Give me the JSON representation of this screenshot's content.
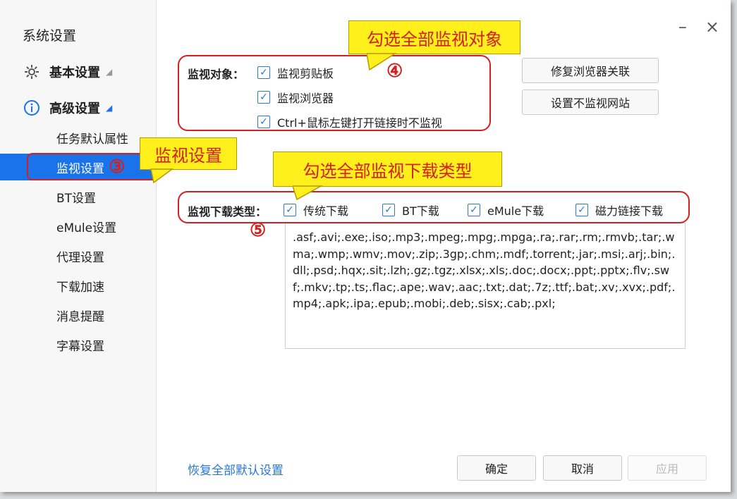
{
  "sidebar": {
    "title": "系统设置",
    "groups": [
      {
        "label": "基本设置",
        "arrow": "◢",
        "icon": "gear-icon"
      },
      {
        "label": "高级设置",
        "arrow": "◢",
        "icon": "info-icon"
      }
    ],
    "items": [
      {
        "label": "任务默认属性"
      },
      {
        "label": "监视设置"
      },
      {
        "label": "BT设置"
      },
      {
        "label": "eMule设置"
      },
      {
        "label": "代理设置"
      },
      {
        "label": "下载加速"
      },
      {
        "label": "消息提醒"
      },
      {
        "label": "字幕设置"
      }
    ]
  },
  "window_controls": {
    "minimize": "–",
    "close": "×"
  },
  "monitor_targets": {
    "label": "监视对象：",
    "options": [
      {
        "label": "监视剪贴板",
        "checked": true
      },
      {
        "label": "监视浏览器",
        "checked": true
      },
      {
        "label": "Ctrl+鼠标左键打开链接时不监视",
        "checked": true
      }
    ],
    "buttons": {
      "repair": "修复浏览器关联",
      "exclude": "设置不监视网站"
    }
  },
  "download_types": {
    "label": "监视下载类型：",
    "options": [
      {
        "label": "传统下载",
        "checked": true
      },
      {
        "label": "BT下载",
        "checked": true
      },
      {
        "label": "eMule下载",
        "checked": true
      },
      {
        "label": "磁力链接下载",
        "checked": true
      }
    ],
    "extensions": ".asf;.avi;.exe;.iso;.mp3;.mpeg;.mpg;.mpga;.ra;.rar;.rm;.rmvb;.tar;.wma;.wmp;.wmv;.mov;.zip;.3gp;.chm;.mdf;.torrent;.jar;.msi;.arj;.bin;.dll;.psd;.hqx;.sit;.lzh;.gz;.tgz;.xlsx;.xls;.doc;.docx;.ppt;.pptx;.flv;.swf;.mkv;.tp;.ts;.flac;.ape;.wav;.aac;.txt;.dat;.7z;.ttf;.bat;.xv;.xvx;.pdf;.mp4;.apk;.ipa;.epub;.mobi;.deb;.sisx;.cab;.pxl;"
  },
  "footer": {
    "restore": "恢复全部默认设置",
    "ok": "确定",
    "cancel": "取消",
    "apply": "应用"
  },
  "annotations": {
    "callout_targets": "勾选全部监视对象",
    "callout_monitor": "监视设置",
    "callout_types": "勾选全部监视下载类型",
    "num3": "③",
    "num4": "④",
    "num5": "⑤"
  },
  "colors": {
    "accent": "#1a73e8",
    "annotation_red": "#d42020",
    "callout_yellow": "#ffef1a"
  }
}
